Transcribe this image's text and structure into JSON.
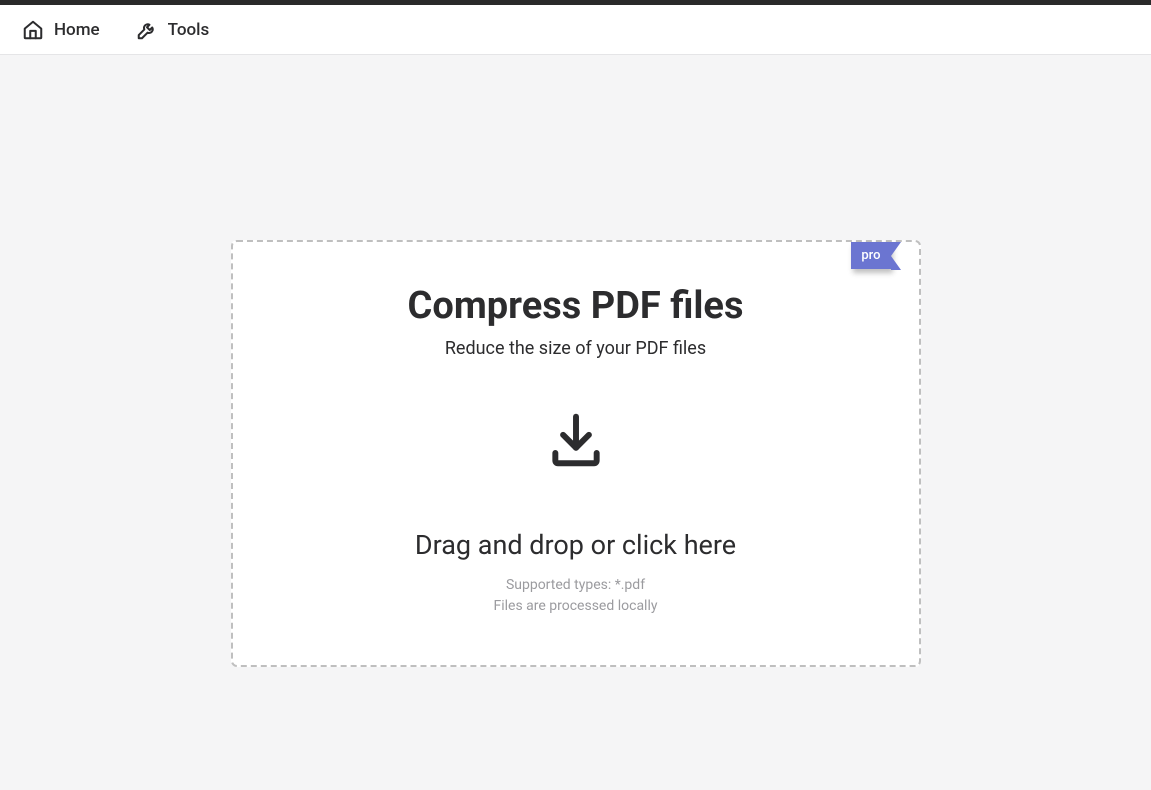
{
  "nav": {
    "home_label": "Home",
    "tools_label": "Tools"
  },
  "card": {
    "badge": "pro",
    "title": "Compress PDF files",
    "subtitle": "Reduce the size of your PDF files",
    "drop_text": "Drag and drop or click here",
    "hint_line1": "Supported types: *.pdf",
    "hint_line2": "Files are processed locally"
  }
}
